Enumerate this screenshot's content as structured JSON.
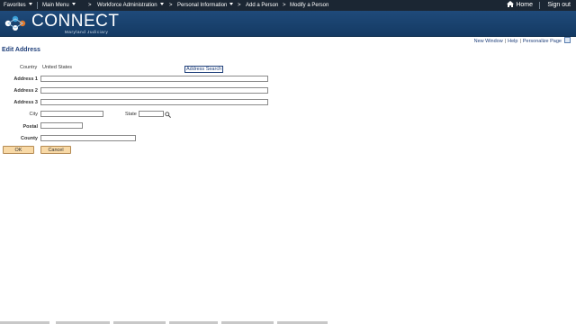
{
  "nav": {
    "favorites": "Favorites",
    "main_menu": "Main Menu",
    "crumbs": [
      "Workforce Administration",
      "Personal Information",
      "Add a Person",
      "Modify a Person"
    ],
    "home": "Home",
    "sign_out": "Sign out"
  },
  "banner": {
    "logo_text": "CONNECT",
    "logo_sub": "Maryland Judiciary"
  },
  "page_links": {
    "new_window": "New Window",
    "help": "Help",
    "personalize": "Personalize Page"
  },
  "page_title": "Edit Address",
  "form": {
    "country_label": "Country",
    "country_value": "United States",
    "address_search": "Address Search",
    "address1_label": "Address 1",
    "address2_label": "Address 2",
    "address3_label": "Address 3",
    "city_label": "City",
    "state_label": "State",
    "postal_label": "Postal",
    "county_label": "County",
    "address1": "",
    "address2": "",
    "address3": "",
    "city": "",
    "state": "",
    "postal": "",
    "county": ""
  },
  "buttons": {
    "ok": "OK",
    "cancel": "Cancel"
  },
  "colors": {
    "nav_bg": "#1b2633",
    "banner_bg": "#1f4a7a",
    "title": "#1f3f7a",
    "button_bg": "#f8d9a6"
  }
}
